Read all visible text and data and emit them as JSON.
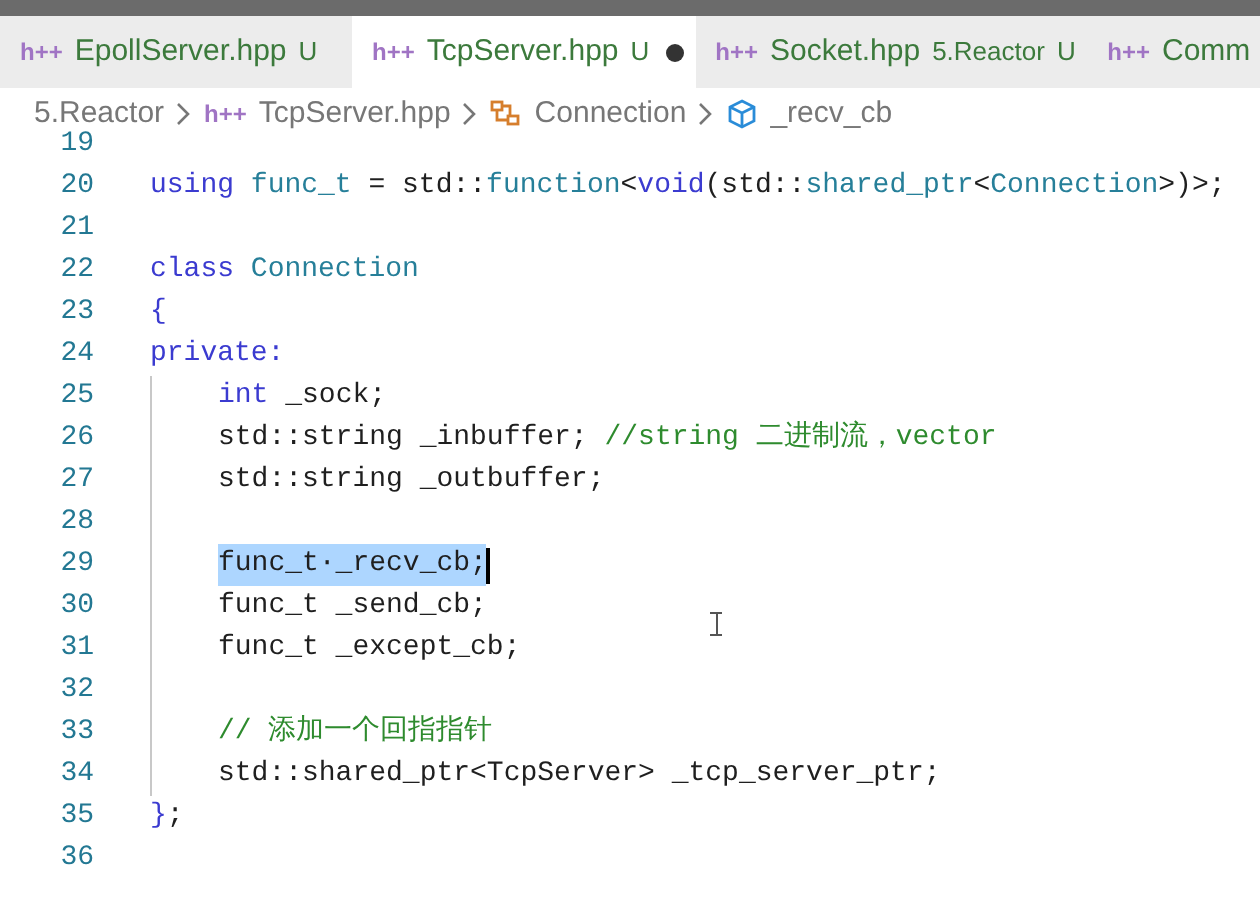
{
  "tabs": [
    {
      "icon": "h++",
      "label": "EpollServer.hpp",
      "status": "U",
      "selected": false,
      "modified": false
    },
    {
      "icon": "h++",
      "label": "TcpServer.hpp",
      "status": "U",
      "selected": true,
      "modified": true
    },
    {
      "icon": "h++",
      "label": "Socket.hpp",
      "description": "5.Reactor",
      "status": "U",
      "selected": false,
      "modified": false
    },
    {
      "icon": "h++",
      "label": "Comm",
      "selected": false,
      "modified": false
    }
  ],
  "breadcrumb": [
    {
      "kind": "folder",
      "label": "5.Reactor"
    },
    {
      "kind": "file",
      "icon": "h++",
      "label": "TcpServer.hpp"
    },
    {
      "kind": "class",
      "label": "Connection"
    },
    {
      "kind": "field",
      "label": "_recv_cb"
    }
  ],
  "lines": [
    {
      "number": "19",
      "indented": false
    },
    {
      "number": "20",
      "indented": false,
      "tokens": [
        {
          "kind": "keyword",
          "text": "using"
        },
        {
          "kind": "type",
          "text": " func_t"
        },
        {
          "kind": "plain",
          "text": " = std::"
        },
        {
          "kind": "type",
          "text": "function"
        },
        {
          "kind": "plain",
          "text": "<"
        },
        {
          "kind": "keyword",
          "text": "void"
        },
        {
          "kind": "plain",
          "text": "(std::"
        },
        {
          "kind": "type",
          "text": "shared_ptr"
        },
        {
          "kind": "plain",
          "text": "<"
        },
        {
          "kind": "type",
          "text": "Connection"
        },
        {
          "kind": "plain",
          "text": ">)>;"
        }
      ]
    },
    {
      "number": "21",
      "indented": false
    },
    {
      "number": "22",
      "indented": false,
      "tokens": [
        {
          "kind": "keyword",
          "text": "class"
        },
        {
          "kind": "type",
          "text": " Connection"
        }
      ]
    },
    {
      "number": "23",
      "indented": false,
      "tokens": [
        {
          "kind": "keyword",
          "text": "{"
        }
      ]
    },
    {
      "number": "24",
      "indented": false,
      "tokens": [
        {
          "kind": "keyword",
          "text": "private:"
        }
      ]
    },
    {
      "number": "25",
      "indented": true,
      "tokens": [
        {
          "kind": "keyword",
          "text": "int"
        },
        {
          "kind": "plain",
          "text": " _sock;"
        }
      ]
    },
    {
      "number": "26",
      "indented": true,
      "tokens": [
        {
          "kind": "plain",
          "text": "std::string _inbuffer; "
        },
        {
          "kind": "comment",
          "text": "//string 二进制流，vector"
        }
      ]
    },
    {
      "number": "27",
      "indented": true,
      "tokens": [
        {
          "kind": "plain",
          "text": "std::string _outbuffer;"
        }
      ]
    },
    {
      "number": "28",
      "indented": true
    },
    {
      "number": "29",
      "indented": true,
      "selected": true,
      "tokens": [
        {
          "kind": "plain",
          "text": "func_t·_recv_cb;"
        }
      ]
    },
    {
      "number": "30",
      "indented": true,
      "tokens": [
        {
          "kind": "plain",
          "text": "func_t _send_cb;"
        }
      ]
    },
    {
      "number": "31",
      "indented": true,
      "tokens": [
        {
          "kind": "plain",
          "text": "func_t _except_cb;"
        }
      ]
    },
    {
      "number": "32",
      "indented": true
    },
    {
      "number": "33",
      "indented": true,
      "tokens": [
        {
          "kind": "comment",
          "text": "// 添加一个回指指针"
        }
      ]
    },
    {
      "number": "34",
      "indented": true,
      "tokens": [
        {
          "kind": "plain",
          "text": "std::shared_ptr<TcpServer> _tcp_server_ptr;"
        }
      ]
    },
    {
      "number": "35",
      "indented": false,
      "tokens": [
        {
          "kind": "keyword",
          "text": "}"
        },
        {
          "kind": "plain",
          "text": ";"
        }
      ]
    },
    {
      "number": "36",
      "indented": false
    }
  ]
}
